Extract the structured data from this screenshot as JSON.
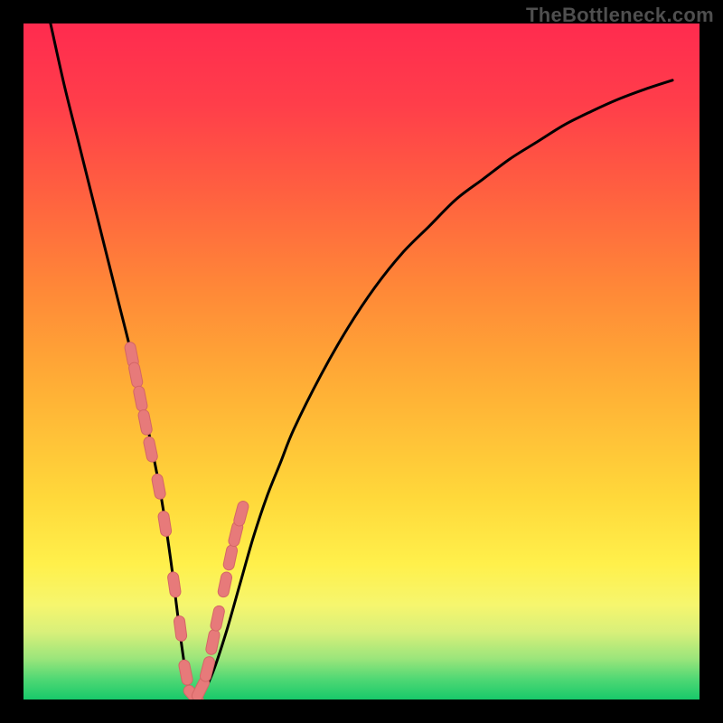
{
  "watermark": "TheBottleneck.com",
  "colors": {
    "frame": "#000000",
    "curve": "#000000",
    "marker_fill": "#e77a7a",
    "marker_stroke": "#d46666",
    "gradient_stops": [
      {
        "offset": 0.0,
        "color": "#ff2b4f"
      },
      {
        "offset": 0.12,
        "color": "#ff3e4a"
      },
      {
        "offset": 0.25,
        "color": "#ff6040"
      },
      {
        "offset": 0.4,
        "color": "#ff8a37"
      },
      {
        "offset": 0.55,
        "color": "#ffb236"
      },
      {
        "offset": 0.7,
        "color": "#ffd83a"
      },
      {
        "offset": 0.8,
        "color": "#fff04b"
      },
      {
        "offset": 0.86,
        "color": "#f6f66e"
      },
      {
        "offset": 0.9,
        "color": "#d9f07a"
      },
      {
        "offset": 0.94,
        "color": "#9ae57b"
      },
      {
        "offset": 0.97,
        "color": "#4fd874"
      },
      {
        "offset": 1.0,
        "color": "#18c96a"
      }
    ]
  },
  "chart_data": {
    "type": "line",
    "title": "",
    "xlabel": "",
    "ylabel": "",
    "xlim": [
      0,
      100
    ],
    "ylim": [
      0,
      100
    ],
    "series": [
      {
        "name": "bottleneck-curve",
        "x": [
          4,
          6,
          8,
          10,
          12,
          14,
          16,
          18,
          20,
          21,
          22,
          23,
          24,
          25,
          26,
          28,
          30,
          32,
          34,
          36,
          38,
          40,
          44,
          48,
          52,
          56,
          60,
          64,
          68,
          72,
          76,
          80,
          84,
          88,
          92,
          96
        ],
        "y": [
          100,
          91,
          83,
          75,
          67,
          59,
          51,
          42,
          32,
          26,
          19,
          11,
          4,
          0,
          0,
          4,
          10,
          17,
          24,
          30,
          35,
          40,
          48,
          55,
          61,
          66,
          70,
          74,
          77,
          80,
          82.5,
          85,
          87,
          88.8,
          90.3,
          91.6
        ]
      }
    ],
    "markers": {
      "name": "highlighted-points",
      "x": [
        16.0,
        16.6,
        17.3,
        18.0,
        18.8,
        20.0,
        20.9,
        22.3,
        23.2,
        24.0,
        25.2,
        26.2,
        27.2,
        28.0,
        28.7,
        29.8,
        30.6,
        31.4,
        32.2
      ],
      "y": [
        51.0,
        48.0,
        44.5,
        41.0,
        37.0,
        31.5,
        26.0,
        17.0,
        10.5,
        4.0,
        0.5,
        1.5,
        4.5,
        8.5,
        12.0,
        17.0,
        21.0,
        24.5,
        27.5
      ]
    }
  }
}
